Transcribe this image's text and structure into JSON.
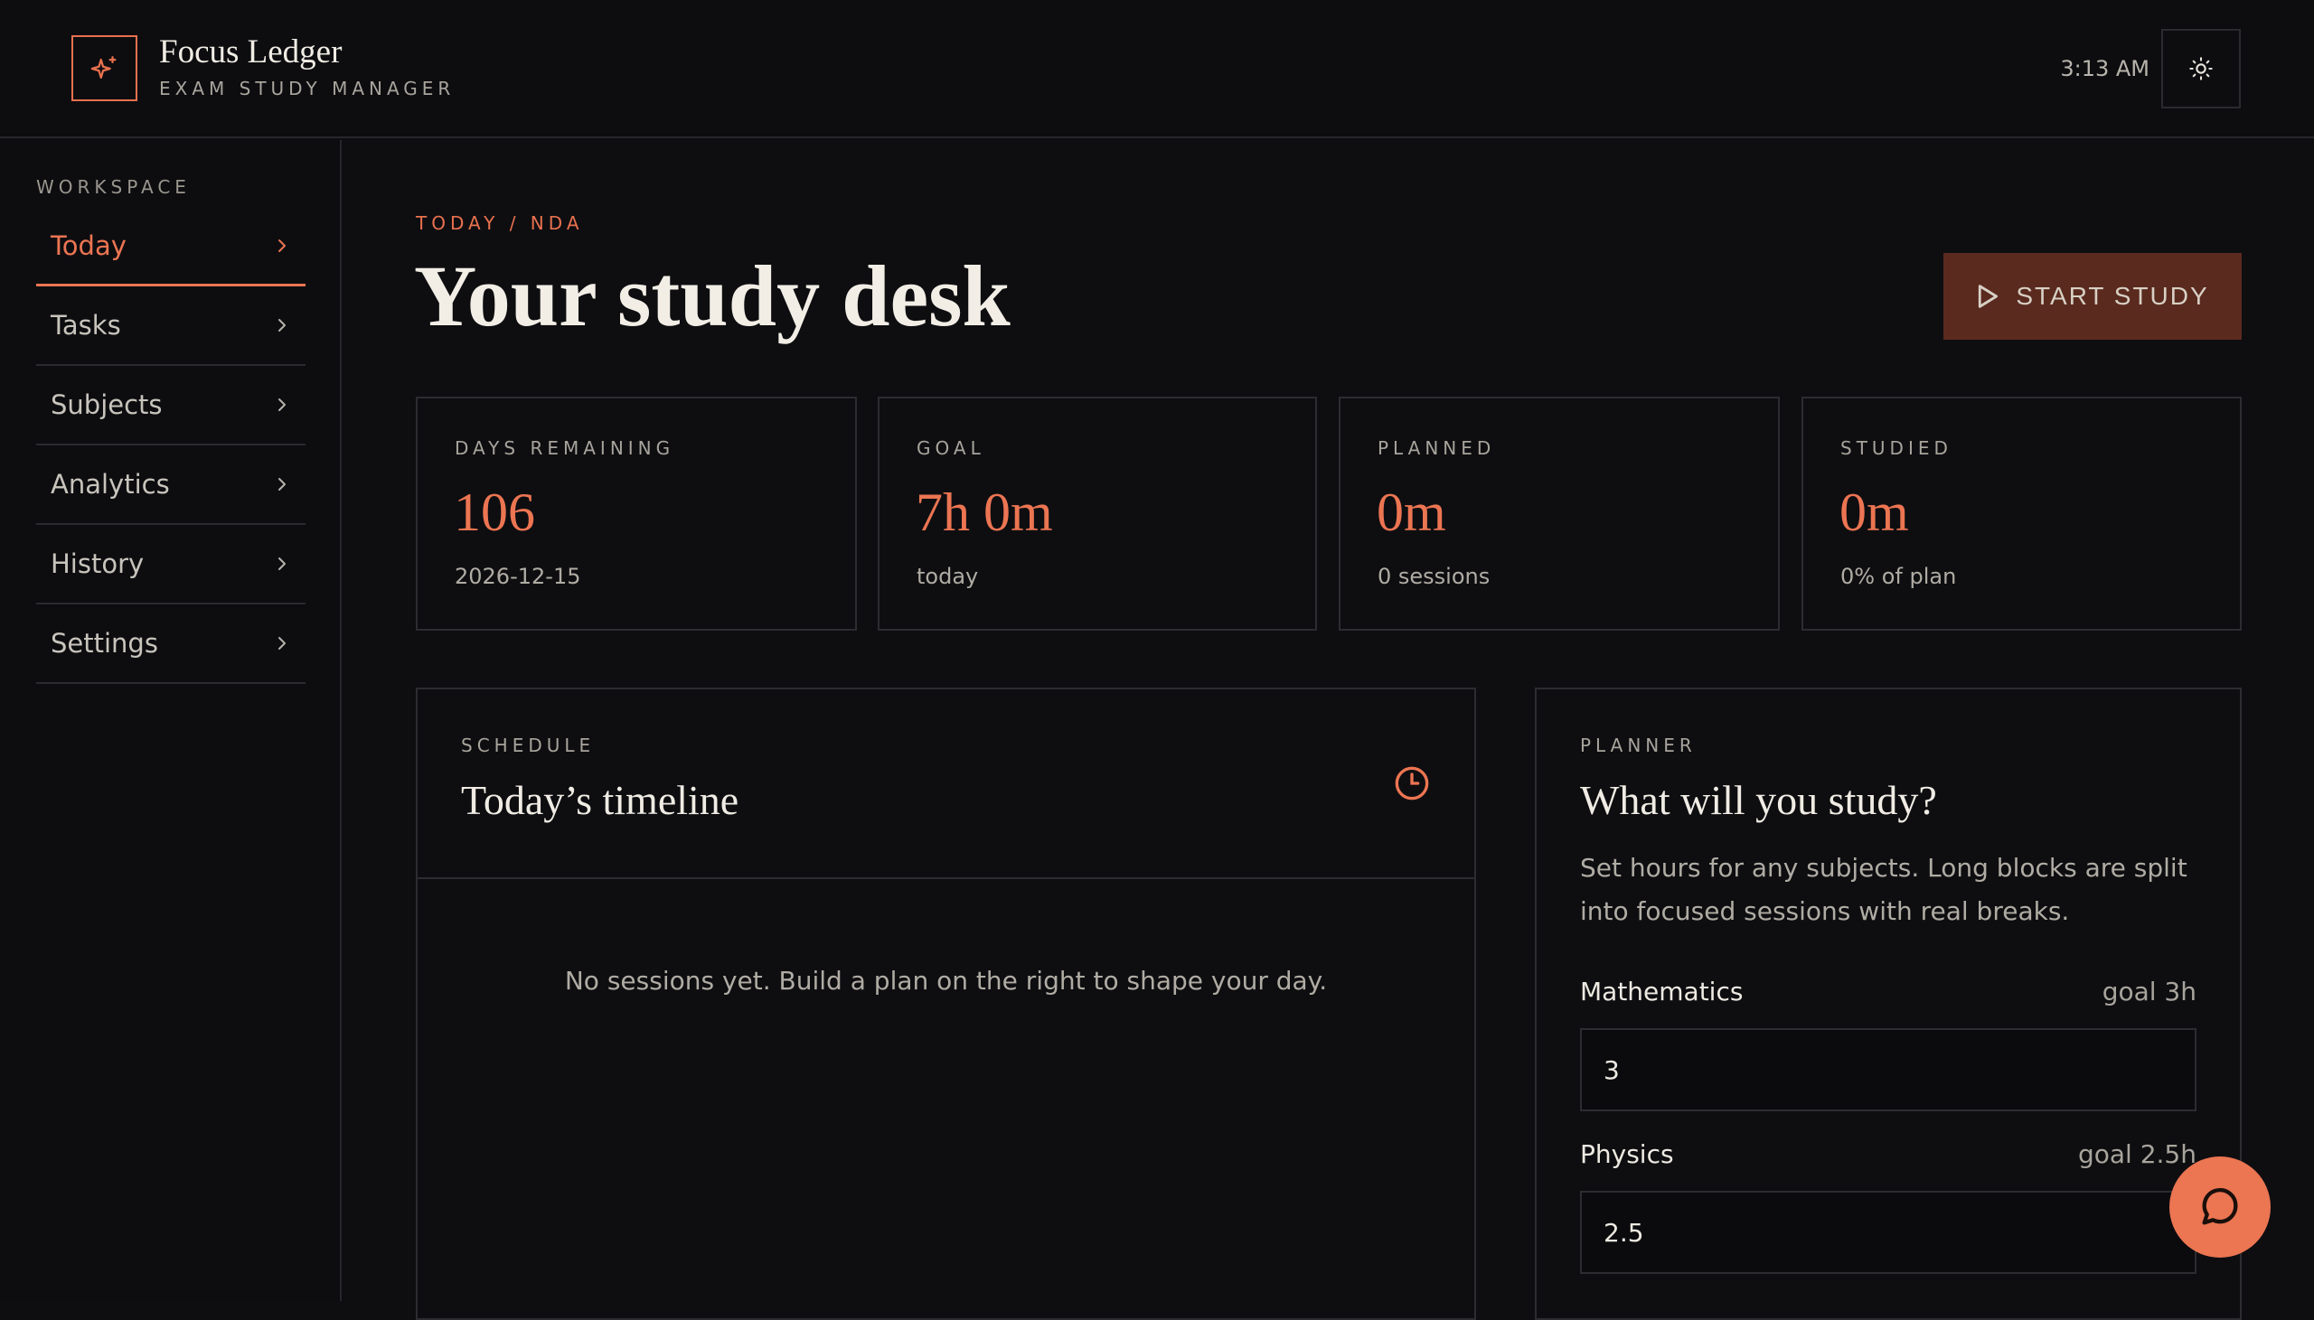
{
  "header": {
    "app_title": "Focus Ledger",
    "app_subtitle": "EXAM STUDY MANAGER",
    "logo_icon": "sparkles-icon",
    "time": "3:13 AM",
    "theme_icon": "sun-icon"
  },
  "sidebar": {
    "heading": "WORKSPACE",
    "items": [
      {
        "label": "Today",
        "active": true
      },
      {
        "label": "Tasks"
      },
      {
        "label": "Subjects"
      },
      {
        "label": "Analytics"
      },
      {
        "label": "History"
      },
      {
        "label": "Settings"
      }
    ]
  },
  "main": {
    "breadcrumb": "TODAY / NDA",
    "title": "Your study desk",
    "start_button": "START STUDY",
    "stats": [
      {
        "label": "DAYS REMAINING",
        "value": "106",
        "sub": "2026-12-15"
      },
      {
        "label": "GOAL",
        "value": "7h 0m",
        "sub": "today"
      },
      {
        "label": "PLANNED",
        "value": "0m",
        "sub": "0 sessions"
      },
      {
        "label": "STUDIED",
        "value": "0m",
        "sub": "0% of plan"
      }
    ],
    "schedule": {
      "eyebrow": "SCHEDULE",
      "title": "Today’s timeline",
      "empty": "No sessions yet. Build a plan on the right to shape your day."
    },
    "planner": {
      "eyebrow": "PLANNER",
      "title": "What will you study?",
      "description": "Set hours for any subjects. Long blocks are split into focused sessions with real breaks.",
      "subjects": [
        {
          "name": "Mathematics",
          "goal": "goal 3h",
          "value": "3"
        },
        {
          "name": "Physics",
          "goal": "goal 2.5h",
          "value": "2.5"
        }
      ]
    }
  },
  "colors": {
    "accent": "#ec7552",
    "background": "#0e0e11",
    "start_button_bg": "#5a2a1f"
  }
}
